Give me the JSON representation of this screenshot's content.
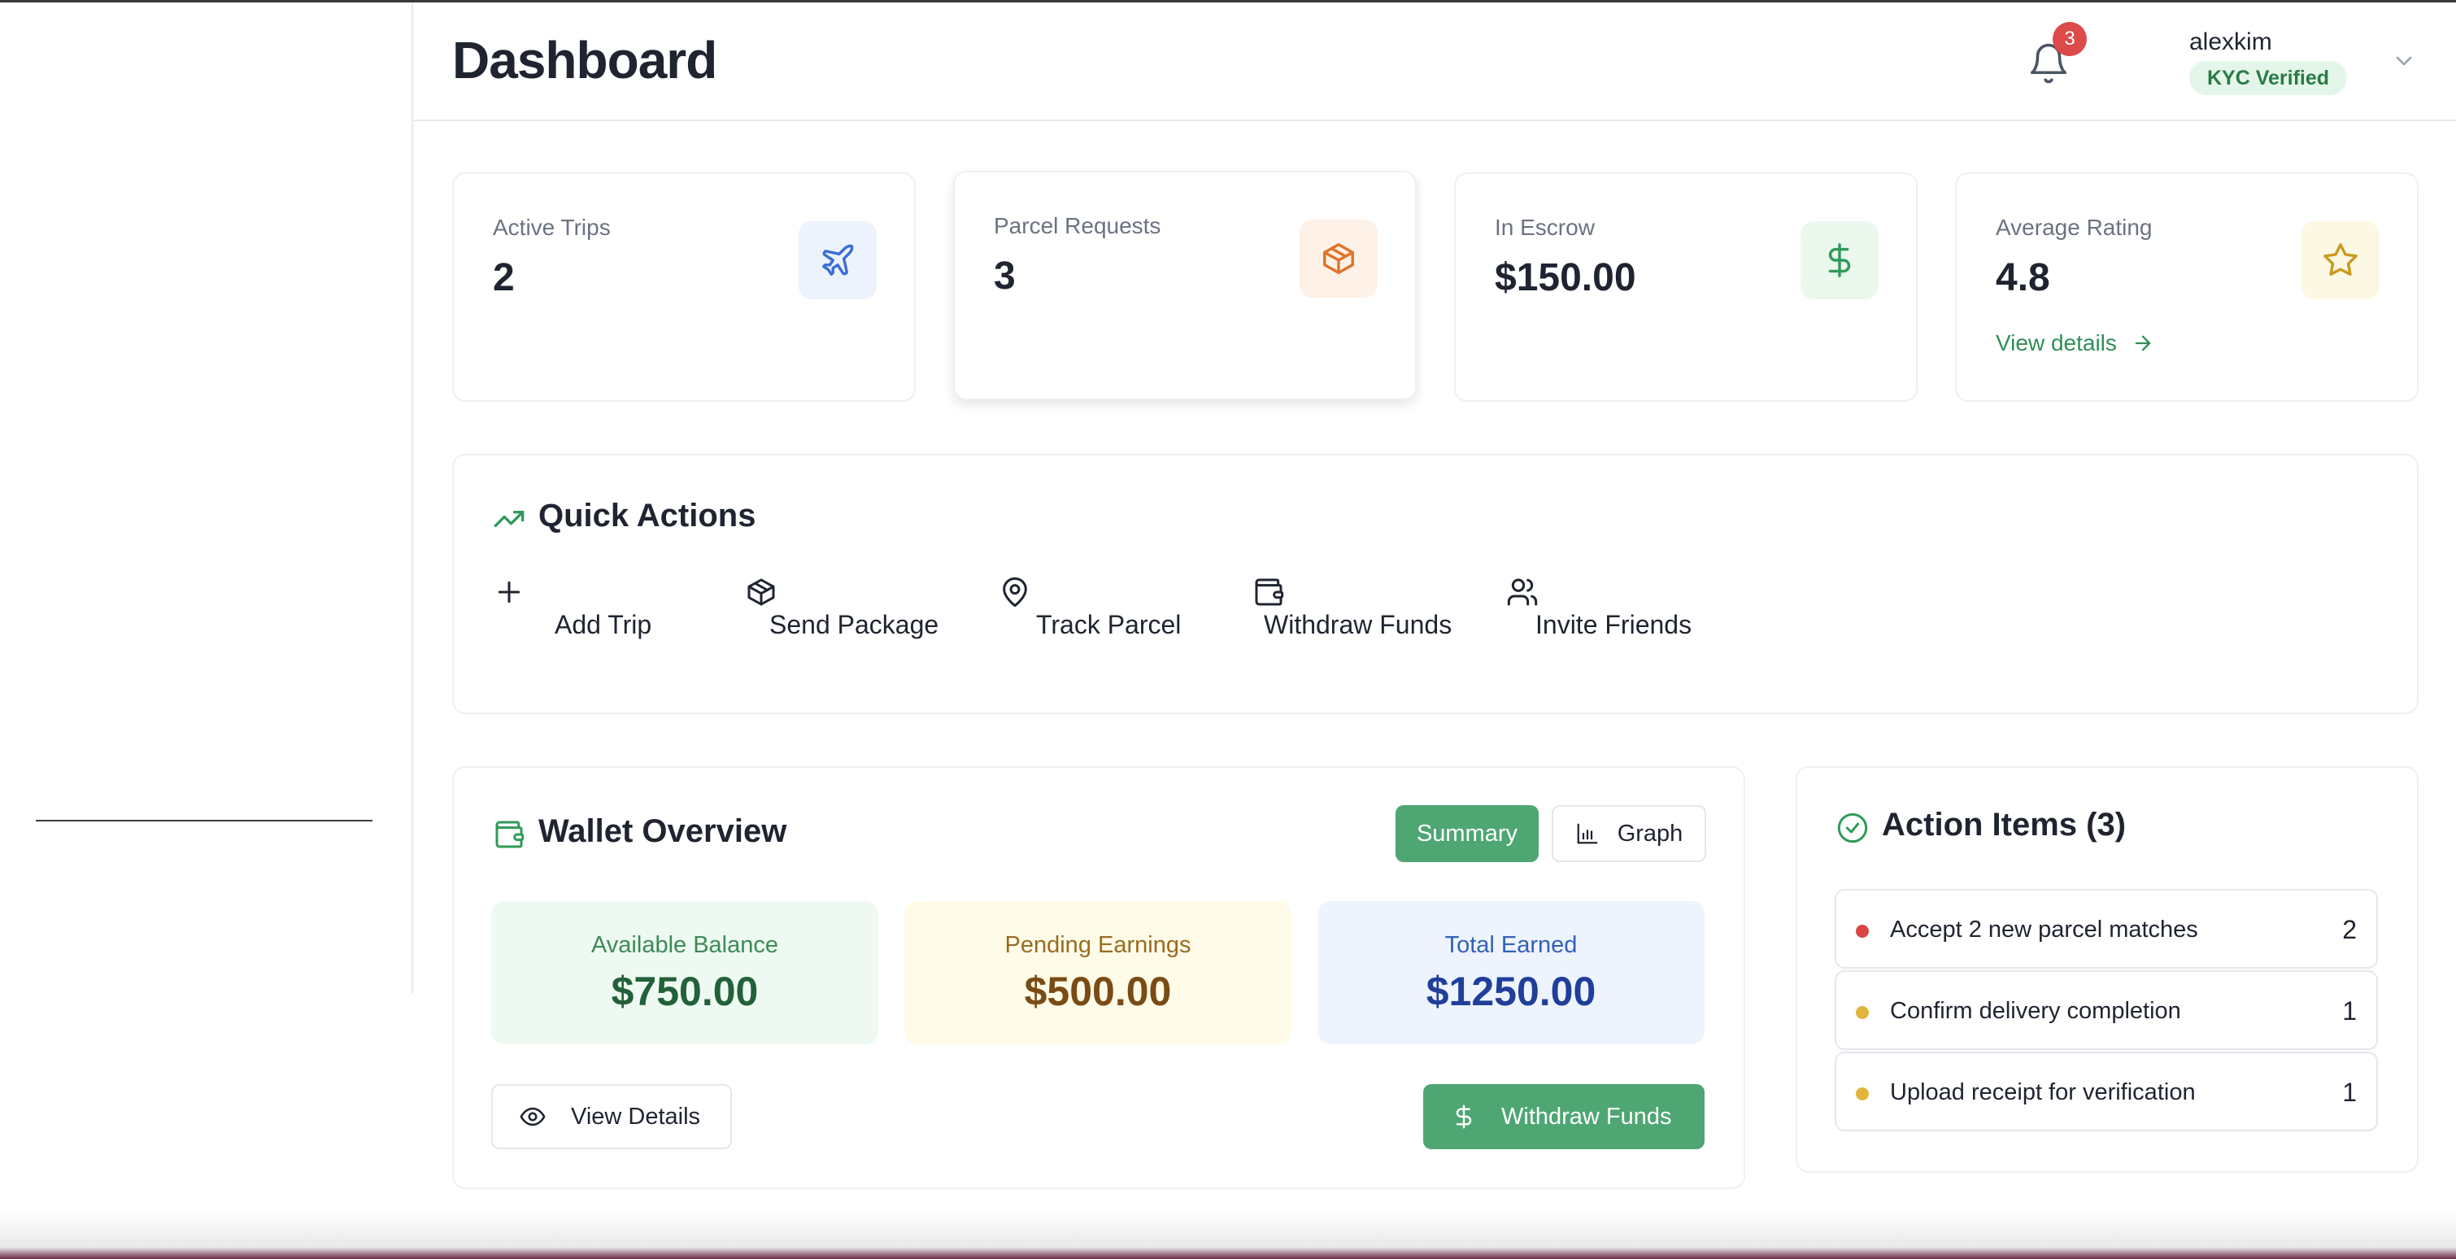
{
  "header": {
    "title": "Dashboard",
    "notification_count": "3",
    "username": "alexkim",
    "kyc_status": "KYC Verified"
  },
  "stats": [
    {
      "label": "Active Trips",
      "value": "2",
      "icon": "plane-icon",
      "color": "#3b6fd4",
      "bg": "#edf3fd"
    },
    {
      "label": "Parcel Requests",
      "value": "3",
      "icon": "package-icon",
      "color": "#e0742a",
      "bg": "#fdf1e8"
    },
    {
      "label": "In Escrow",
      "value": "$150.00",
      "icon": "dollar-icon",
      "color": "#2f9a58",
      "bg": "#eaf8ee"
    },
    {
      "label": "Average Rating",
      "value": "4.8",
      "icon": "star-icon",
      "color": "#c99a1e",
      "bg": "#fdf8e4",
      "link": "View details"
    }
  ],
  "quick_actions": {
    "title": "Quick Actions",
    "items": [
      {
        "label": "Add Trip",
        "icon": "plus-icon"
      },
      {
        "label": "Send Package",
        "icon": "package-icon"
      },
      {
        "label": "Track Parcel",
        "icon": "map-pin-icon"
      },
      {
        "label": "Withdraw Funds",
        "icon": "wallet-icon"
      },
      {
        "label": "Invite Friends",
        "icon": "users-icon"
      }
    ]
  },
  "wallet": {
    "title": "Wallet Overview",
    "tabs": {
      "summary": "Summary",
      "graph": "Graph"
    },
    "balances": [
      {
        "label": "Available Balance",
        "value": "$750.00",
        "bg": "#eefaf1",
        "label_color": "#3d8a57",
        "value_color": "#22613a"
      },
      {
        "label": "Pending Earnings",
        "value": "$500.00",
        "bg": "#fefbe8",
        "label_color": "#9a6b21",
        "value_color": "#7a4b14"
      },
      {
        "label": "Total Earned",
        "value": "$1250.00",
        "bg": "#edf4fe",
        "label_color": "#3560b8",
        "value_color": "#1f3f9a"
      }
    ],
    "view_details": "View Details",
    "withdraw": "Withdraw Funds"
  },
  "action_items": {
    "title": "Action Items (3)",
    "items": [
      {
        "label": "Accept 2 new parcel matches",
        "count": "2",
        "color": "#d94545"
      },
      {
        "label": "Confirm delivery completion",
        "count": "1",
        "color": "#e0b53a"
      },
      {
        "label": "Upload receipt for verification",
        "count": "1",
        "color": "#e0b53a"
      }
    ]
  },
  "colors": {
    "accent": "#4ea673",
    "text": "#1f2430",
    "muted": "#6b7280"
  }
}
